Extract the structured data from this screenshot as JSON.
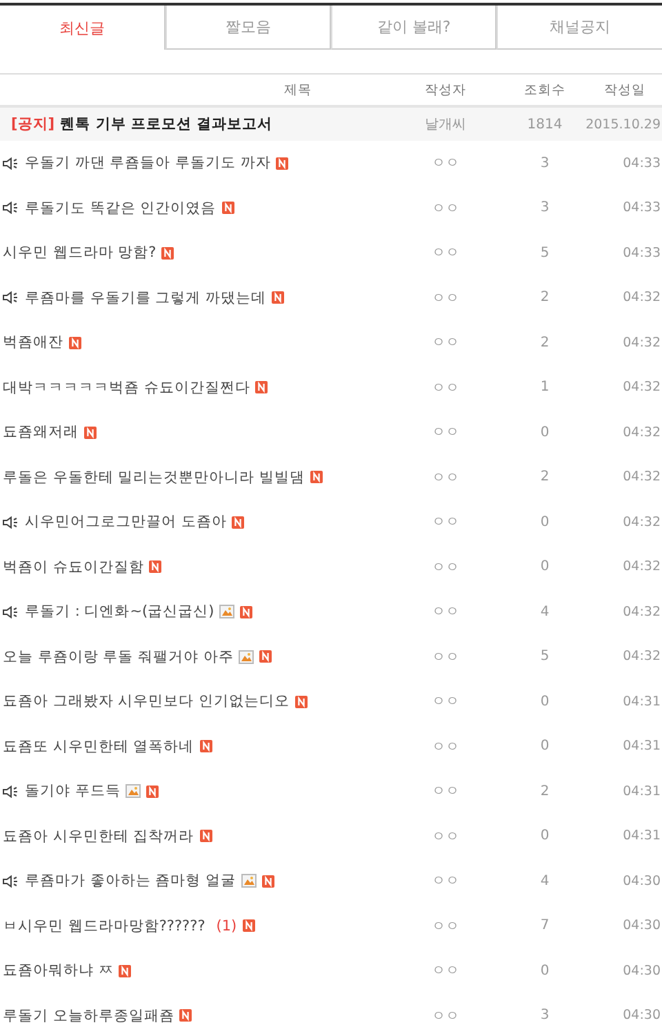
{
  "tabs": [
    {
      "label": "최신글",
      "selected": true
    },
    {
      "label": "짤모음",
      "selected": false
    },
    {
      "label": "같이 볼래?",
      "selected": false
    },
    {
      "label": "채널공지",
      "selected": false
    }
  ],
  "table": {
    "columns": [
      "제목",
      "작성자",
      "조회수",
      "작성일"
    ],
    "notice": {
      "tag": "[공지]",
      "title": "퀜톡 기부 프로모션 결과보고서",
      "author": "날개씨",
      "views": "1814",
      "date": "2015.10.29"
    },
    "rows": [
      {
        "speaker": true,
        "title": "우돌기 까댄 루죰들아 루돌기도 까자",
        "has_image": false,
        "new": true,
        "author": "ㅇㅇ",
        "views": "3",
        "date": "04:33"
      },
      {
        "speaker": true,
        "title": "루돌기도 똑같은 인간이였음",
        "has_image": false,
        "new": true,
        "author": "ㅇㅇ",
        "views": "3",
        "date": "04:33"
      },
      {
        "speaker": false,
        "title": "시우민 웹드라마 망함?",
        "has_image": false,
        "new": true,
        "author": "ㅇㅇ",
        "views": "5",
        "date": "04:33"
      },
      {
        "speaker": true,
        "title": "루죰마를 우돌기를 그렇게 까댔는데",
        "has_image": false,
        "new": true,
        "author": "ㅇㅇ",
        "views": "2",
        "date": "04:32"
      },
      {
        "speaker": false,
        "title": "벅죰애잔",
        "has_image": false,
        "new": true,
        "author": "ㅇㅇ",
        "views": "2",
        "date": "04:32"
      },
      {
        "speaker": false,
        "title": "대박ㅋㅋㅋㅋㅋ벅죰 슈됴이간질쩐다",
        "has_image": false,
        "new": true,
        "author": "ㅇㅇ",
        "views": "1",
        "date": "04:32"
      },
      {
        "speaker": false,
        "title": "됴죰왜저래",
        "has_image": false,
        "new": true,
        "author": "ㅇㅇ",
        "views": "0",
        "date": "04:32"
      },
      {
        "speaker": false,
        "title": "루돌은 우돌한테 밀리는것뿐만아니라 빌빌댐",
        "has_image": false,
        "new": true,
        "author": "ㅇㅇ",
        "views": "2",
        "date": "04:32"
      },
      {
        "speaker": true,
        "title": "시우민어그로그만끌어 도죰아",
        "has_image": false,
        "new": true,
        "author": "ㅇㅇ",
        "views": "0",
        "date": "04:32"
      },
      {
        "speaker": false,
        "title": "벅죰이 슈됴이간질함",
        "has_image": false,
        "new": true,
        "author": "ㅇㅇ",
        "views": "0",
        "date": "04:32"
      },
      {
        "speaker": true,
        "title": "루돌기 : 디엔화~(굽신굽신)",
        "has_image": true,
        "new": true,
        "author": "ㅇㅇ",
        "views": "4",
        "date": "04:32"
      },
      {
        "speaker": false,
        "title": "오늘 루죰이랑 루돌 줘팰거야 아주",
        "has_image": true,
        "new": true,
        "author": "ㅇㅇ",
        "views": "5",
        "date": "04:32"
      },
      {
        "speaker": false,
        "title": "됴죰아 그래봤자 시우민보다 인기없는디오",
        "has_image": false,
        "new": true,
        "author": "ㅇㅇ",
        "views": "0",
        "date": "04:31"
      },
      {
        "speaker": false,
        "title": "됴죰또 시우민한테 열폭하네",
        "has_image": false,
        "new": true,
        "author": "ㅇㅇ",
        "views": "0",
        "date": "04:31"
      },
      {
        "speaker": true,
        "title": "돌기야 푸드득",
        "has_image": true,
        "new": true,
        "author": "ㅇㅇ",
        "views": "2",
        "date": "04:31"
      },
      {
        "speaker": false,
        "title": "됴죰아 시우민한테 집착꺼라",
        "has_image": false,
        "new": true,
        "author": "ㅇㅇ",
        "views": "0",
        "date": "04:31"
      },
      {
        "speaker": true,
        "title": "루죰마가 좋아하는 죰마형 얼굴",
        "has_image": true,
        "new": true,
        "author": "ㅇㅇ",
        "views": "4",
        "date": "04:30"
      },
      {
        "speaker": false,
        "title": "ㅂ시우민 웹드라마망함??????",
        "has_image": false,
        "comments": "(1)",
        "new": true,
        "author": "ㅇㅇ",
        "views": "7",
        "date": "04:30"
      },
      {
        "speaker": false,
        "title": "됴죰아뭐하냐 ㅉ",
        "has_image": false,
        "new": true,
        "author": "ㅇㅇ",
        "views": "0",
        "date": "04:30"
      },
      {
        "speaker": false,
        "title": "루돌기 오늘하루종일패죰",
        "has_image": false,
        "new": true,
        "author": "ㅇㅇ",
        "views": "3",
        "date": "04:30"
      }
    ]
  }
}
